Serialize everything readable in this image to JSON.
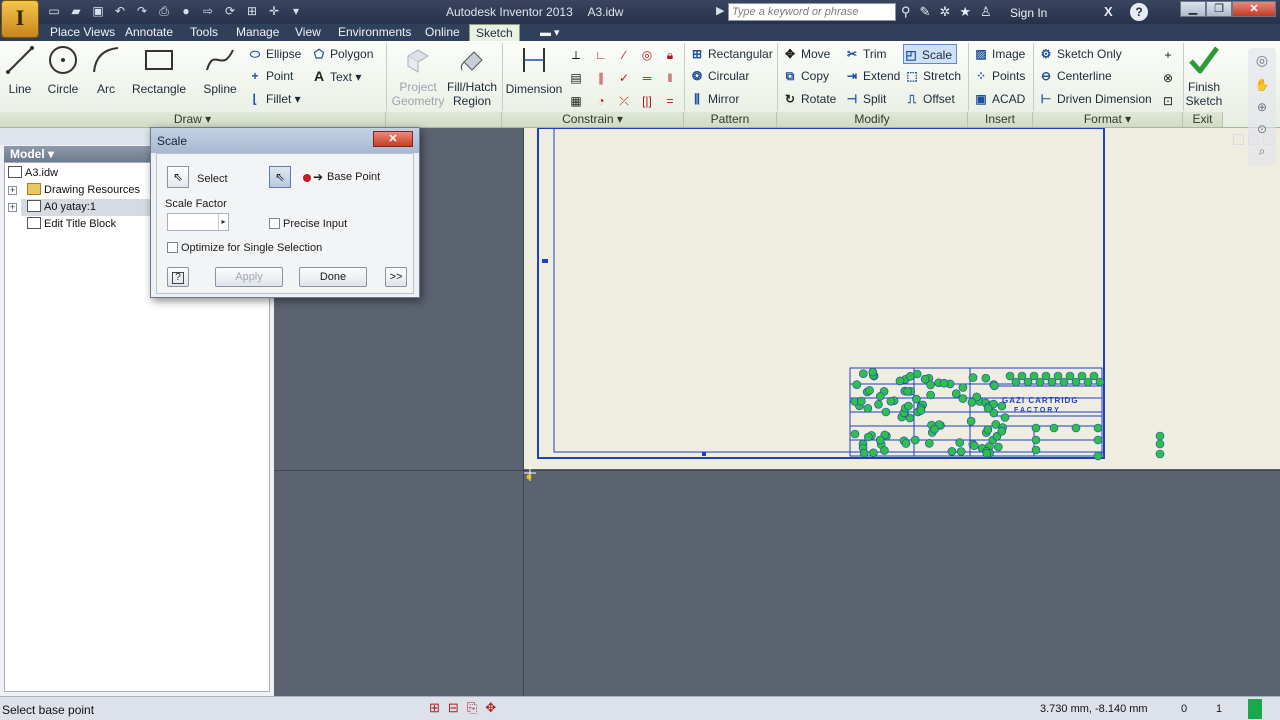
{
  "window": {
    "app_name": "Autodesk Inventor 2013",
    "document": "A3.idw",
    "search_placeholder": "Type a keyword or phrase",
    "sign_in": "Sign In"
  },
  "tabs": [
    "Place Views",
    "Annotate",
    "Tools",
    "Manage",
    "View",
    "Environments",
    "Online",
    "Sketch"
  ],
  "active_tab": "Sketch",
  "ribbon": {
    "draw": {
      "label": "Draw",
      "big": [
        "Line",
        "Circle",
        "Arc",
        "Rectangle",
        "Spline"
      ],
      "small": [
        "Ellipse",
        "Point",
        "Fillet",
        "Polygon",
        "Text"
      ]
    },
    "geometry": {
      "project_l1": "Project",
      "project_l2": "Geometry",
      "fill_l1": "Fill/Hatch",
      "fill_l2": "Region"
    },
    "constrain": {
      "label": "Constrain",
      "dimension": "Dimension"
    },
    "pattern": {
      "label": "Pattern",
      "items": [
        "Rectangular",
        "Circular",
        "Mirror"
      ]
    },
    "modify": {
      "label": "Modify",
      "items": [
        "Move",
        "Copy",
        "Rotate",
        "Trim",
        "Extend",
        "Split",
        "Scale",
        "Stretch",
        "Offset"
      ]
    },
    "insert": {
      "label": "Insert",
      "items": [
        "Image",
        "Points",
        "ACAD"
      ]
    },
    "format": {
      "label": "Format",
      "items": [
        "Sketch Only",
        "Centerline",
        "Driven Dimension"
      ]
    },
    "exit": {
      "label": "Exit",
      "finish_l1": "Finish",
      "finish_l2": "Sketch"
    }
  },
  "browser": {
    "header": "Model",
    "items": [
      "A3.idw",
      "Drawing Resources",
      "A0 yatay:1",
      "Edit Title Block"
    ]
  },
  "dialog": {
    "title": "Scale",
    "select": "Select",
    "base_point": "Base Point",
    "scale_factor_label": "Scale Factor",
    "scale_factor_value": "",
    "precise_input": "Precise Input",
    "optimize": "Optimize for Single Selection",
    "apply": "Apply",
    "done": "Done",
    "more": ">>",
    "help": "?"
  },
  "title_block": {
    "line1": "GAZI CARTRIDG",
    "line2": "F A C T O R Y"
  },
  "status": {
    "prompt": "Select base point",
    "coords": "3.730 mm, -8.140 mm",
    "n1": "0",
    "n2": "1"
  },
  "colors": {
    "accent_blue": "#1f3fbf",
    "grip_green": "#2fbf4a",
    "sheet": "#efece0",
    "canvas_bg": "#5b6270"
  }
}
